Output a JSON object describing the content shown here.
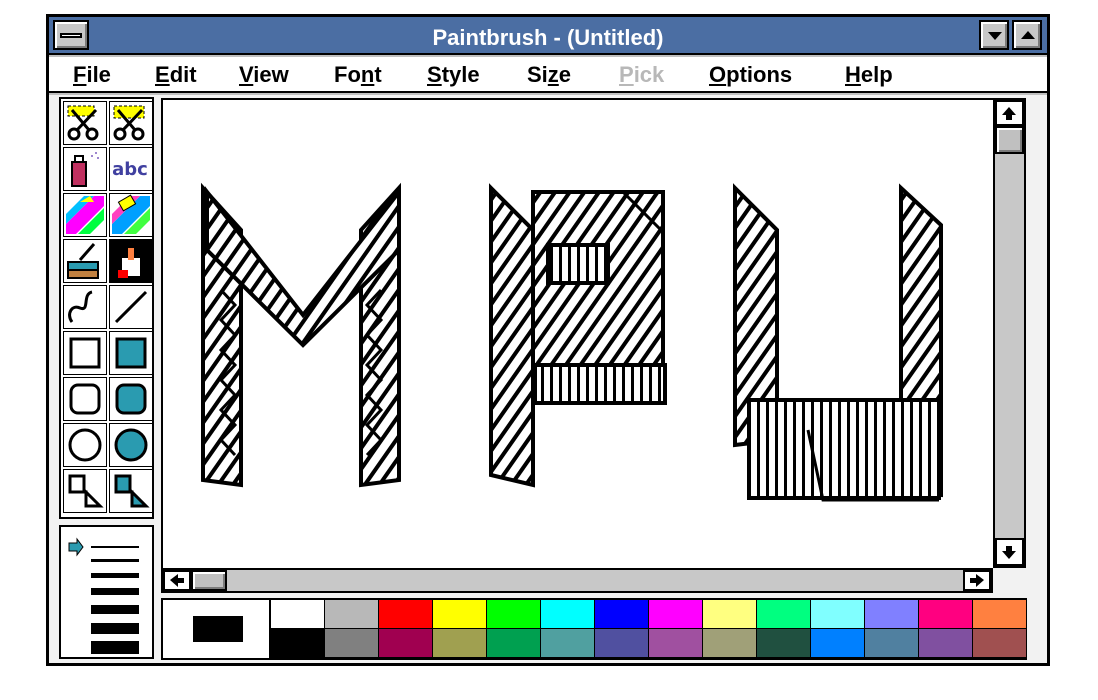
{
  "window": {
    "title": "Paintbrush - (Untitled)",
    "menu": [
      {
        "label": "File",
        "underline": 0
      },
      {
        "label": "Edit",
        "underline": 0
      },
      {
        "label": "View",
        "underline": 0
      },
      {
        "label": "Font",
        "underline": 2
      },
      {
        "label": "Style",
        "underline": 0
      },
      {
        "label": "Size",
        "underline": 2
      },
      {
        "label": "Pick",
        "underline": 0,
        "disabled": true
      },
      {
        "label": "Options",
        "underline": 0
      },
      {
        "label": "Help",
        "underline": 0
      }
    ]
  },
  "tools": [
    {
      "name": "scissors-pick-icon"
    },
    {
      "name": "scissors-rect-pick-icon"
    },
    {
      "name": "airbrush-icon"
    },
    {
      "name": "text-tool-icon",
      "label": "abc"
    },
    {
      "name": "color-eraser-icon"
    },
    {
      "name": "eraser-icon"
    },
    {
      "name": "paint-roller-icon"
    },
    {
      "name": "brush-icon"
    },
    {
      "name": "curve-icon"
    },
    {
      "name": "line-icon"
    },
    {
      "name": "box-icon"
    },
    {
      "name": "filled-box-icon"
    },
    {
      "name": "rounded-box-icon"
    },
    {
      "name": "filled-rounded-box-icon"
    },
    {
      "name": "circle-icon"
    },
    {
      "name": "filled-circle-icon"
    },
    {
      "name": "polygon-icon"
    },
    {
      "name": "filled-polygon-icon"
    }
  ],
  "canvas_art_text": "MPU",
  "palette": {
    "foreground": "#000000",
    "background": "#ffffff",
    "top": [
      "#ffffff",
      "#b8b8b8",
      "#ff0000",
      "#ffff00",
      "#00ff00",
      "#00ffff",
      "#0000ff",
      "#ff00ff",
      "#ffff80",
      "#00ff80",
      "#80ffff",
      "#8080ff",
      "#ff0080",
      "#ff8040"
    ],
    "bottom": [
      "#000000",
      "#808080",
      "#a00050",
      "#a0a050",
      "#00a050",
      "#50a0a0",
      "#5050a0",
      "#a050a0",
      "#a0a078",
      "#205040",
      "#0080ff",
      "#5080a0",
      "#8050a0",
      "#a05050"
    ]
  }
}
